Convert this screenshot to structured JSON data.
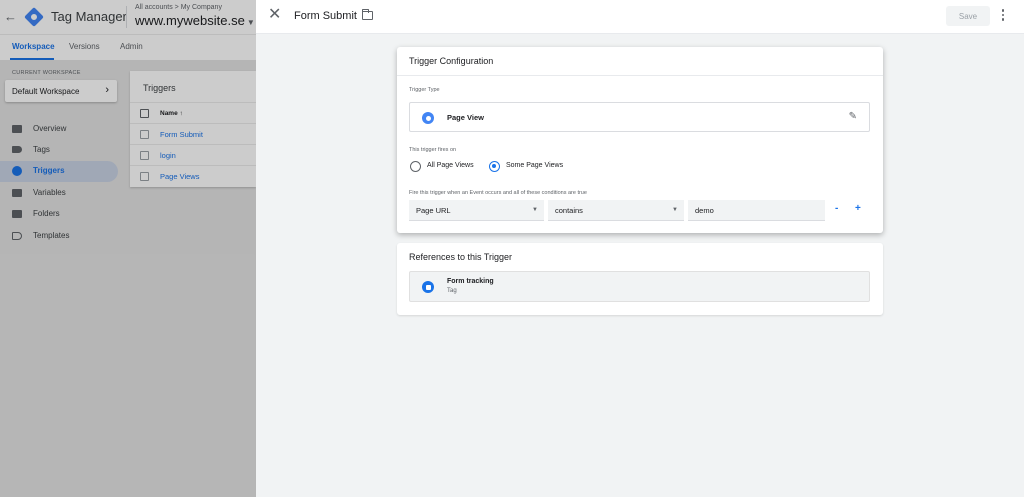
{
  "background": {
    "app_title": "Tag Manager",
    "account_breadcrumb": "All accounts > My Company",
    "container_name": "www.mywebsite.se",
    "nav_tabs": [
      {
        "label": "Workspace",
        "active": true
      },
      {
        "label": "Versions",
        "active": false
      },
      {
        "label": "Admin",
        "active": false
      }
    ],
    "workspace_caption": "CURRENT WORKSPACE",
    "workspace_name": "Default Workspace",
    "sidebar": [
      {
        "label": "Overview",
        "icon": "overview-icon",
        "active": false
      },
      {
        "label": "Tags",
        "icon": "tag-icon",
        "active": false
      },
      {
        "label": "Triggers",
        "icon": "trigger-icon",
        "active": true
      },
      {
        "label": "Variables",
        "icon": "variables-icon",
        "active": false
      },
      {
        "label": "Folders",
        "icon": "folder-icon",
        "active": false
      },
      {
        "label": "Templates",
        "icon": "template-icon",
        "active": false
      }
    ],
    "triggers_panel": {
      "title": "Triggers",
      "column_header": "Name ↑",
      "rows": [
        "Form Submit",
        "login",
        "Page Views"
      ]
    }
  },
  "panel": {
    "title": "Form Submit",
    "save_label": "Save",
    "config_card": {
      "title": "Trigger Configuration",
      "trigger_type_caption": "Trigger Type",
      "trigger_type": "Page View",
      "fires_on_caption": "This trigger fires on",
      "options": [
        {
          "label": "All Page Views",
          "checked": false
        },
        {
          "label": "Some Page Views",
          "checked": true
        }
      ],
      "condition_caption": "Fire this trigger when an Event occurs and all of these conditions are true",
      "condition": {
        "variable": "Page URL",
        "operator": "contains",
        "value": "demo"
      },
      "remove_label": "-",
      "add_label": "+"
    },
    "refs_card": {
      "title": "References to this Trigger",
      "ref_name": "Form tracking",
      "ref_type": "Tag"
    }
  },
  "colors": {
    "accent": "#1a73e8",
    "overlay_bg": "#f1f3f4",
    "card_bg": "#ffffff"
  }
}
